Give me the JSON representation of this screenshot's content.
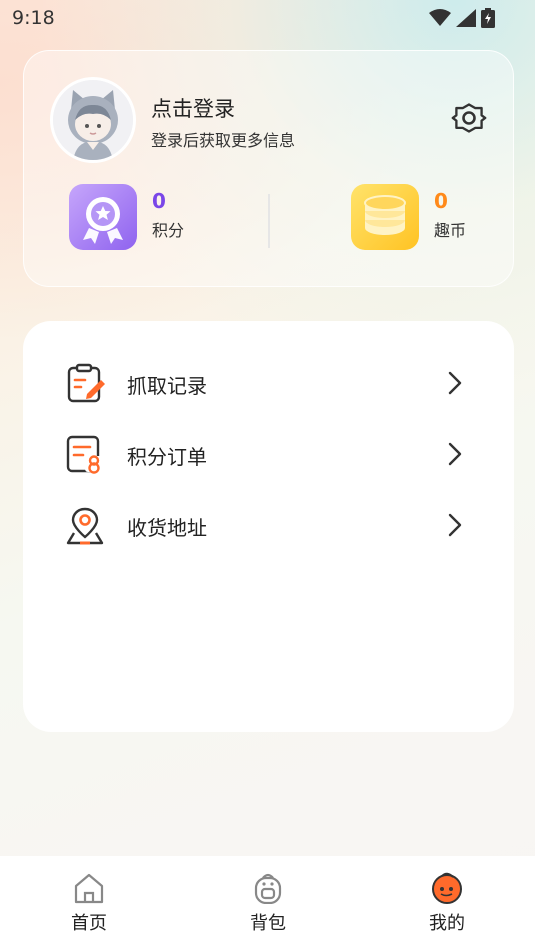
{
  "status_bar": {
    "time": "9:18",
    "icons": [
      "wifi-icon",
      "signal-icon",
      "battery-charging-icon"
    ]
  },
  "profile": {
    "avatar_icon": "default-avatar-icon",
    "login_title": "点击登录",
    "login_subtitle": "登录后获取更多信息",
    "settings_icon": "gear-icon",
    "stats": {
      "points": {
        "value": "0",
        "label": "积分",
        "icon": "medal-badge-icon",
        "color": "#7a46e8"
      },
      "coins": {
        "value": "0",
        "label": "趣币",
        "icon": "coin-stack-icon",
        "color": "#ff8a1a"
      }
    }
  },
  "menu": {
    "items": [
      {
        "label": "抓取记录",
        "icon": "clipboard-record-icon"
      },
      {
        "label": "积分订单",
        "icon": "points-order-icon"
      },
      {
        "label": "收货地址",
        "icon": "location-pin-icon"
      }
    ],
    "arrow_icon": "chevron-right-icon"
  },
  "bottom_nav": {
    "items": [
      {
        "label": "首页",
        "icon": "home-icon",
        "active": false
      },
      {
        "label": "背包",
        "icon": "backpack-icon",
        "active": false
      },
      {
        "label": "我的",
        "icon": "profile-face-icon",
        "active": true
      }
    ]
  },
  "colors": {
    "accent_orange": "#ff6a2b",
    "points_purple": "#7a46e8",
    "coins_orange": "#ff8a1a"
  }
}
